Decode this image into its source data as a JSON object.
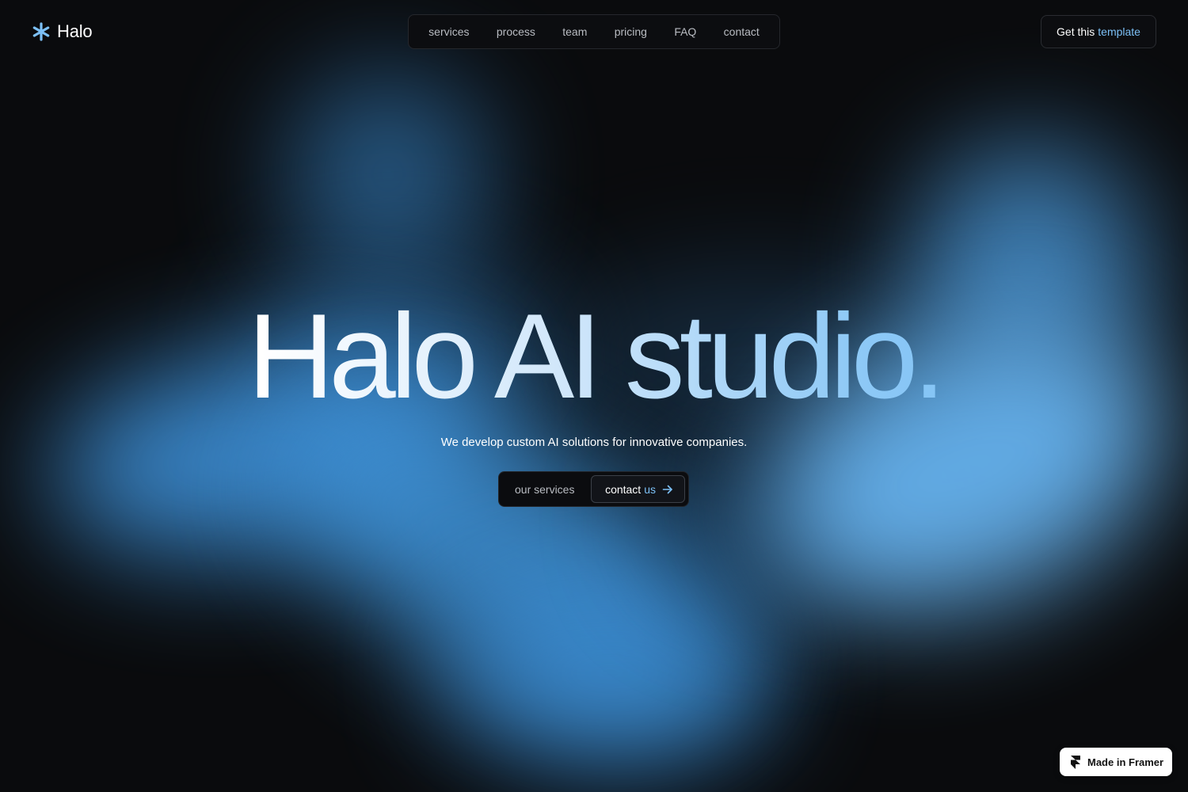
{
  "brand": {
    "name": "Halo",
    "icon": "asterisk-icon",
    "accent_color": "#7cc0f6"
  },
  "nav": {
    "items": [
      {
        "label": "services"
      },
      {
        "label": "process"
      },
      {
        "label": "team"
      },
      {
        "label": "pricing"
      },
      {
        "label": "FAQ"
      },
      {
        "label": "contact"
      }
    ]
  },
  "header_cta": {
    "label_prefix": "Get this",
    "label_accent": "template"
  },
  "hero": {
    "title": "Halo AI studio.",
    "subtitle": "We develop custom AI solutions for innovative companies.",
    "secondary_button": "our services",
    "primary_button_prefix": "contact",
    "primary_button_accent": "us",
    "primary_button_icon": "arrow-right-icon"
  },
  "badge": {
    "label": "Made in Framer",
    "icon": "framer-icon"
  },
  "colors": {
    "background": "#0a0b0d",
    "glow": "#4a9de0"
  }
}
